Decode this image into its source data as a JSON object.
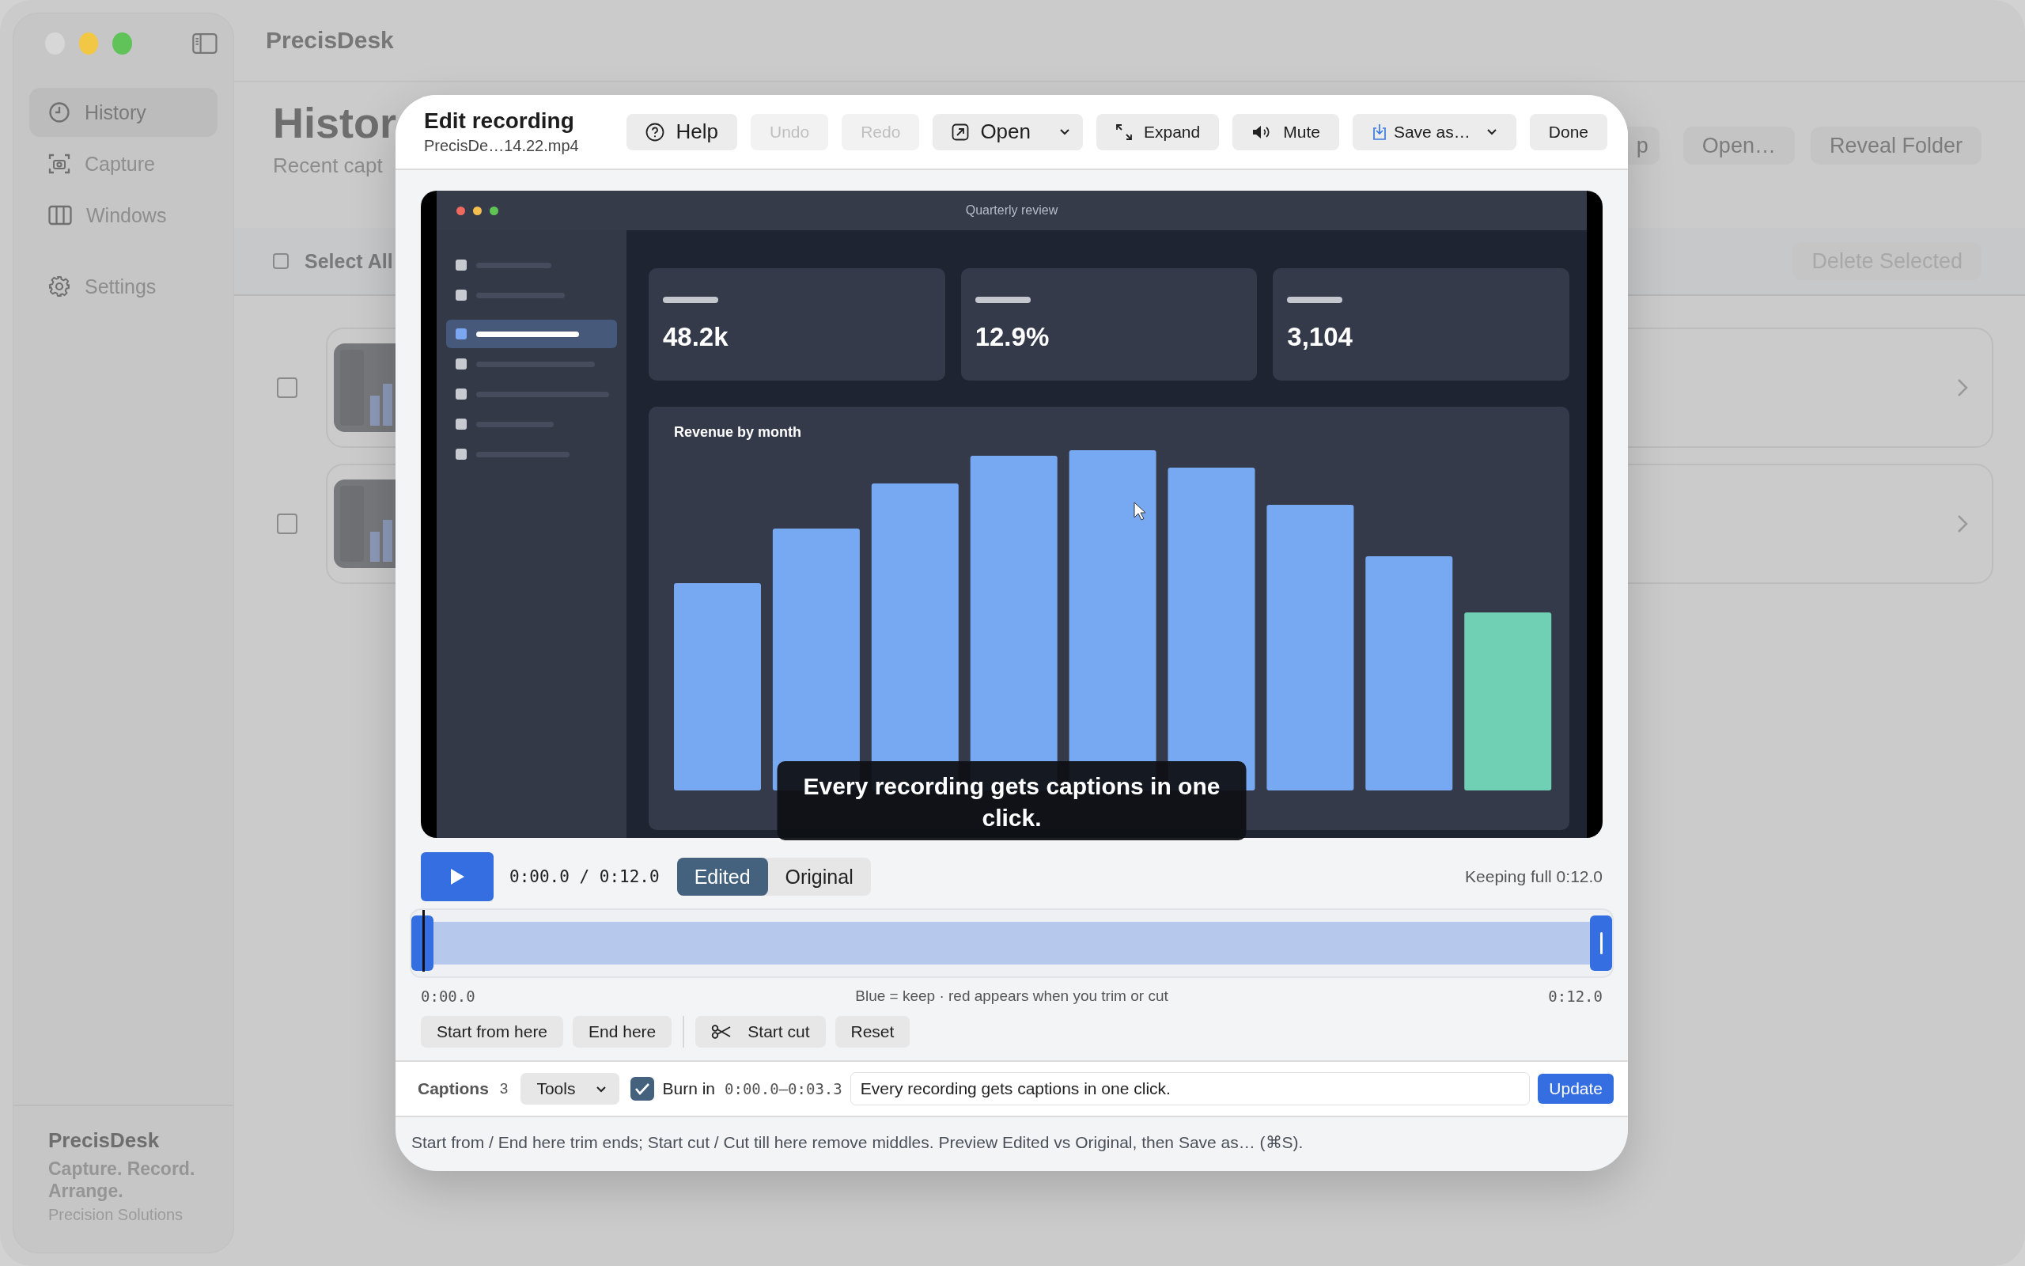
{
  "window": {
    "title": "PrecisDesk"
  },
  "sidebar": {
    "items": [
      {
        "label": "History",
        "selected": true
      },
      {
        "label": "Capture",
        "selected": false
      },
      {
        "label": "Windows",
        "selected": false
      }
    ],
    "settings": {
      "label": "Settings",
      "selected": false
    },
    "footer": {
      "name": "PrecisDesk",
      "tagline": "Capture. Record. Arrange.",
      "company": "Precision Solutions"
    }
  },
  "main": {
    "title": "Histor",
    "subtitle": "Recent capt",
    "actions": [
      "p",
      "Open…",
      "Reveal Folder"
    ],
    "select_all": {
      "label": "Select All",
      "checked": false
    },
    "delete_button": {
      "label": "Delete Selected",
      "disabled": true
    },
    "rows": [
      {
        "checked": false
      },
      {
        "checked": false
      }
    ]
  },
  "dialog": {
    "title": "Edit recording",
    "filename": "PrecisDe…14.22.mp4",
    "toolbar": [
      {
        "label": "Help",
        "disabled": false,
        "menu": false
      },
      {
        "label": "Undo",
        "disabled": true,
        "menu": false
      },
      {
        "label": "Redo",
        "disabled": true,
        "menu": false
      },
      {
        "label": "Open",
        "disabled": false,
        "menu": true
      },
      {
        "label": "Expand",
        "disabled": false,
        "menu": false
      },
      {
        "label": "Mute",
        "disabled": false,
        "menu": false
      },
      {
        "label": "Save as…",
        "disabled": false,
        "menu": true
      },
      {
        "label": "Done",
        "disabled": false,
        "menu": false
      }
    ],
    "preview": {
      "app_title": "Quarterly review",
      "nav": [
        {
          "selected": false
        },
        {
          "selected": false
        },
        {
          "selected": true
        },
        {
          "selected": false
        },
        {
          "selected": false
        },
        {
          "selected": false
        },
        {
          "selected": false
        }
      ],
      "stats": [
        {
          "value": "48.2k"
        },
        {
          "value": "12.9%"
        },
        {
          "value": "3,104"
        }
      ],
      "chart_title": "Revenue by month",
      "caption": "Every recording gets captions in one click."
    },
    "playback": {
      "time": "0:00.0 / 0:12.0",
      "views": [
        {
          "label": "Edited",
          "selected": true
        },
        {
          "label": "Original",
          "selected": false
        }
      ],
      "keeping": "Keeping full 0:12.0"
    },
    "timeline": {
      "level": 0,
      "start_label": "0:00.0",
      "legend": "Blue = keep · red appears when you trim or cut",
      "end_label": "0:12.0"
    },
    "edit_buttons": [
      "Start from here",
      "End here",
      "Start cut",
      "Reset"
    ],
    "captions": {
      "label": "Captions",
      "count": "3",
      "menu": "Tools",
      "burn_in": {
        "label": "Burn in",
        "checked": true
      },
      "range": "0:00.0–0:03.3",
      "text": "Every recording gets captions in one click.",
      "button": "Update"
    },
    "hint": "Start from / End here trim ends; Start cut / Cut till here remove middles. Preview Edited vs Original, then Save as… (⌘S)."
  }
}
